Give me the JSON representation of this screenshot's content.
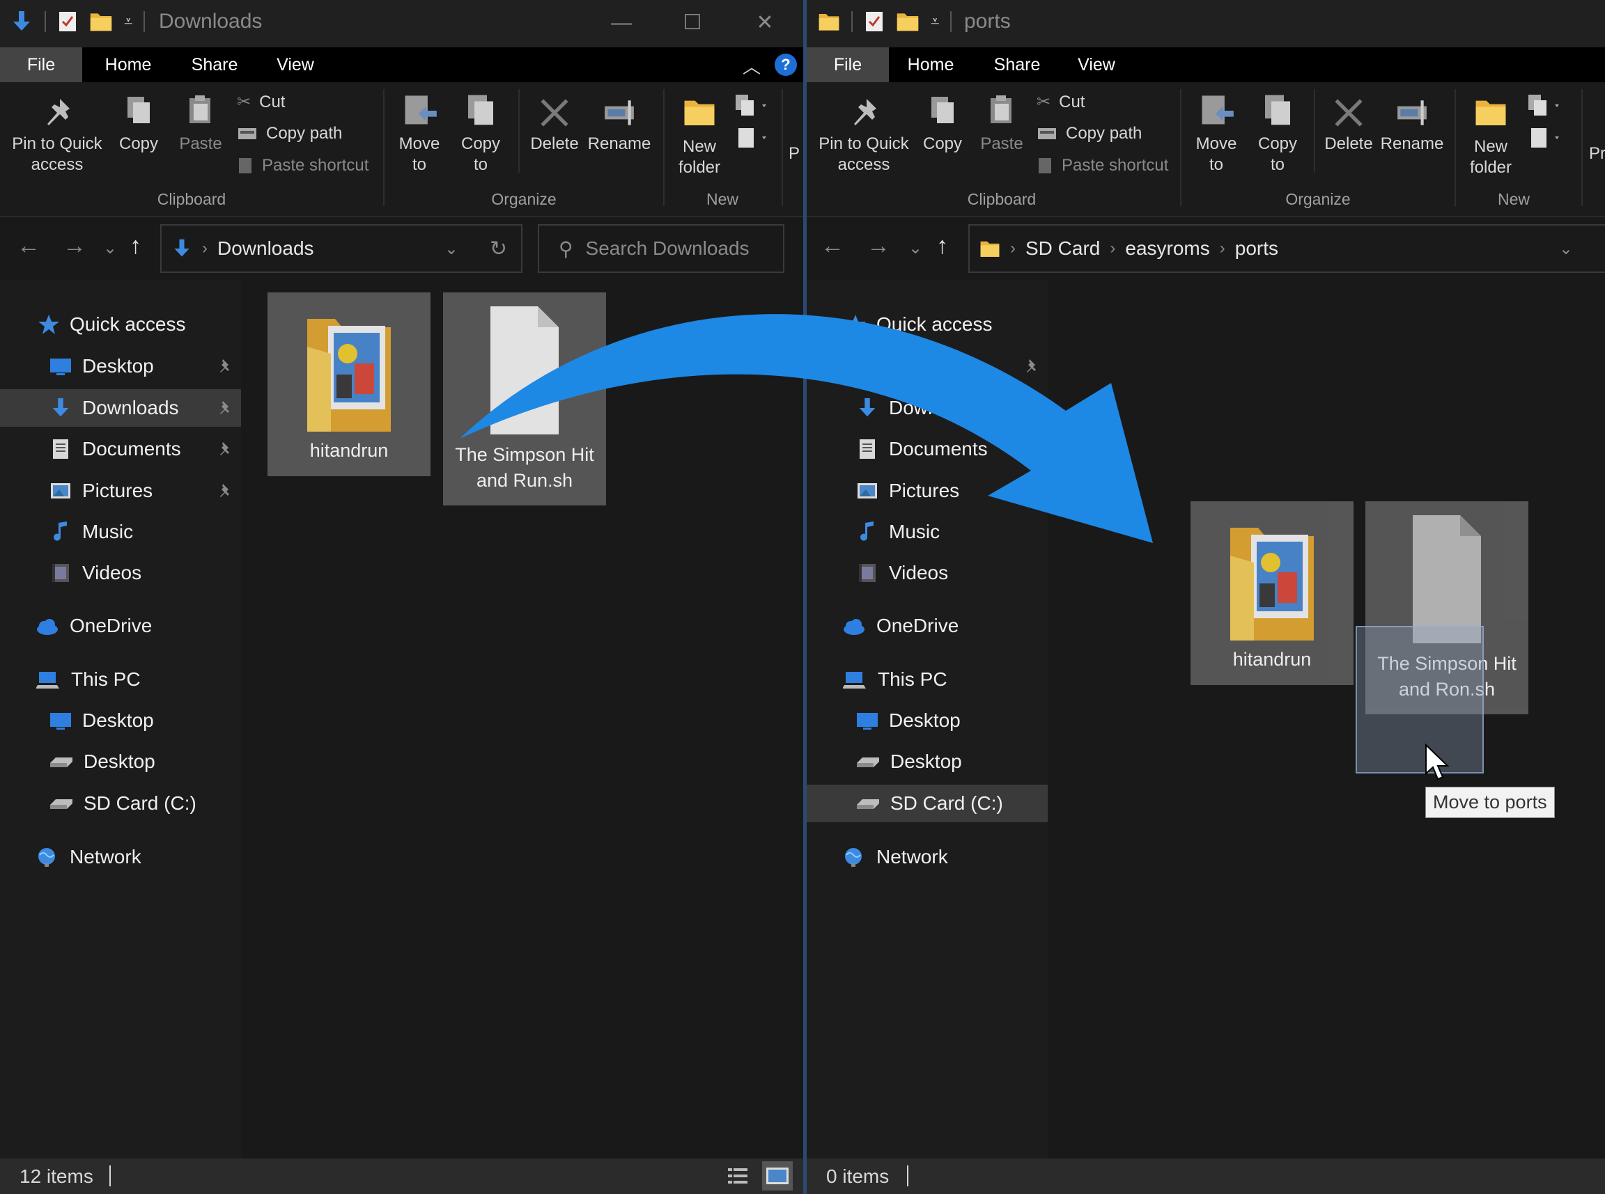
{
  "left_window": {
    "title": "Downloads",
    "tabs": [
      "File",
      "Home",
      "Share",
      "View"
    ],
    "ribbon": {
      "pin_label": "Pin to Quick access",
      "copy_label": "Copy",
      "paste_label": "Paste",
      "cut_label": "Cut",
      "copy_path_label": "Copy path",
      "paste_shortcut_label": "Paste shortcut",
      "clipboard_group": "Clipboard",
      "move_to_label": "Move to",
      "copy_to_label": "Copy to",
      "delete_label": "Delete",
      "rename_label": "Rename",
      "organize_group": "Organize",
      "new_folder_label": "New folder",
      "new_group": "New",
      "overflow_label": "P"
    },
    "address": {
      "crumbs": [
        "Downloads"
      ]
    },
    "search_placeholder": "Search Downloads",
    "nav": [
      {
        "label": "Quick access"
      },
      {
        "label": "Desktop"
      },
      {
        "label": "Downloads"
      },
      {
        "label": "Documents"
      },
      {
        "label": "Pictures"
      },
      {
        "label": "Music"
      },
      {
        "label": "Videos"
      },
      {
        "label": "OneDrive"
      },
      {
        "label": "This PC"
      },
      {
        "label": "Desktop"
      },
      {
        "label": "Desktop"
      },
      {
        "label": "SD Card (C:)"
      },
      {
        "label": "Network"
      }
    ],
    "files": [
      {
        "line1": "hitandrun",
        "line2": ""
      },
      {
        "line1": "The Simpson Hit",
        "line2": "and Run.sh"
      }
    ],
    "status": "12 items"
  },
  "right_window": {
    "title": "ports",
    "tabs": [
      "File",
      "Home",
      "Share",
      "View"
    ],
    "ribbon": {
      "pin_label": "Pin to Quick access",
      "copy_label": "Copy",
      "paste_label": "Paste",
      "cut_label": "Cut",
      "copy_path_label": "Copy path",
      "paste_shortcut_label": "Paste shortcut",
      "clipboard_group": "Clipboard",
      "move_to_label": "Move to",
      "copy_to_label": "Copy to",
      "delete_label": "Delete",
      "rename_label": "Rename",
      "organize_group": "Organize",
      "new_folder_label": "New folder",
      "new_group": "New",
      "overflow_label": "Pr"
    },
    "address": {
      "crumbs": [
        "SD Card",
        "easyroms",
        "ports"
      ]
    },
    "nav": [
      {
        "label": "Quick access"
      },
      {
        "label": "Downloads"
      },
      {
        "label": "Documents"
      },
      {
        "label": "Pictures"
      },
      {
        "label": "Music"
      },
      {
        "label": "Videos"
      },
      {
        "label": "OneDrive"
      },
      {
        "label": "This PC"
      },
      {
        "label": "Desktop"
      },
      {
        "label": "Desktop"
      },
      {
        "label": "SD Card (C:)"
      },
      {
        "label": "Network"
      }
    ],
    "files": [
      {
        "line1": "hitandrun",
        "line2": ""
      },
      {
        "line1": "The Simpson Hit",
        "line2": "and Ron.sh"
      }
    ],
    "tooltip": "Move to ports",
    "status": "0 items"
  },
  "colors": {
    "accent_blue": "#1e88e5",
    "background": "#191919",
    "folder_yellow": "#f3c350"
  },
  "icons": {
    "folder": "folder-icon",
    "file": "file-icon",
    "pin": "pin-icon",
    "arrow": "drag-arrow"
  }
}
